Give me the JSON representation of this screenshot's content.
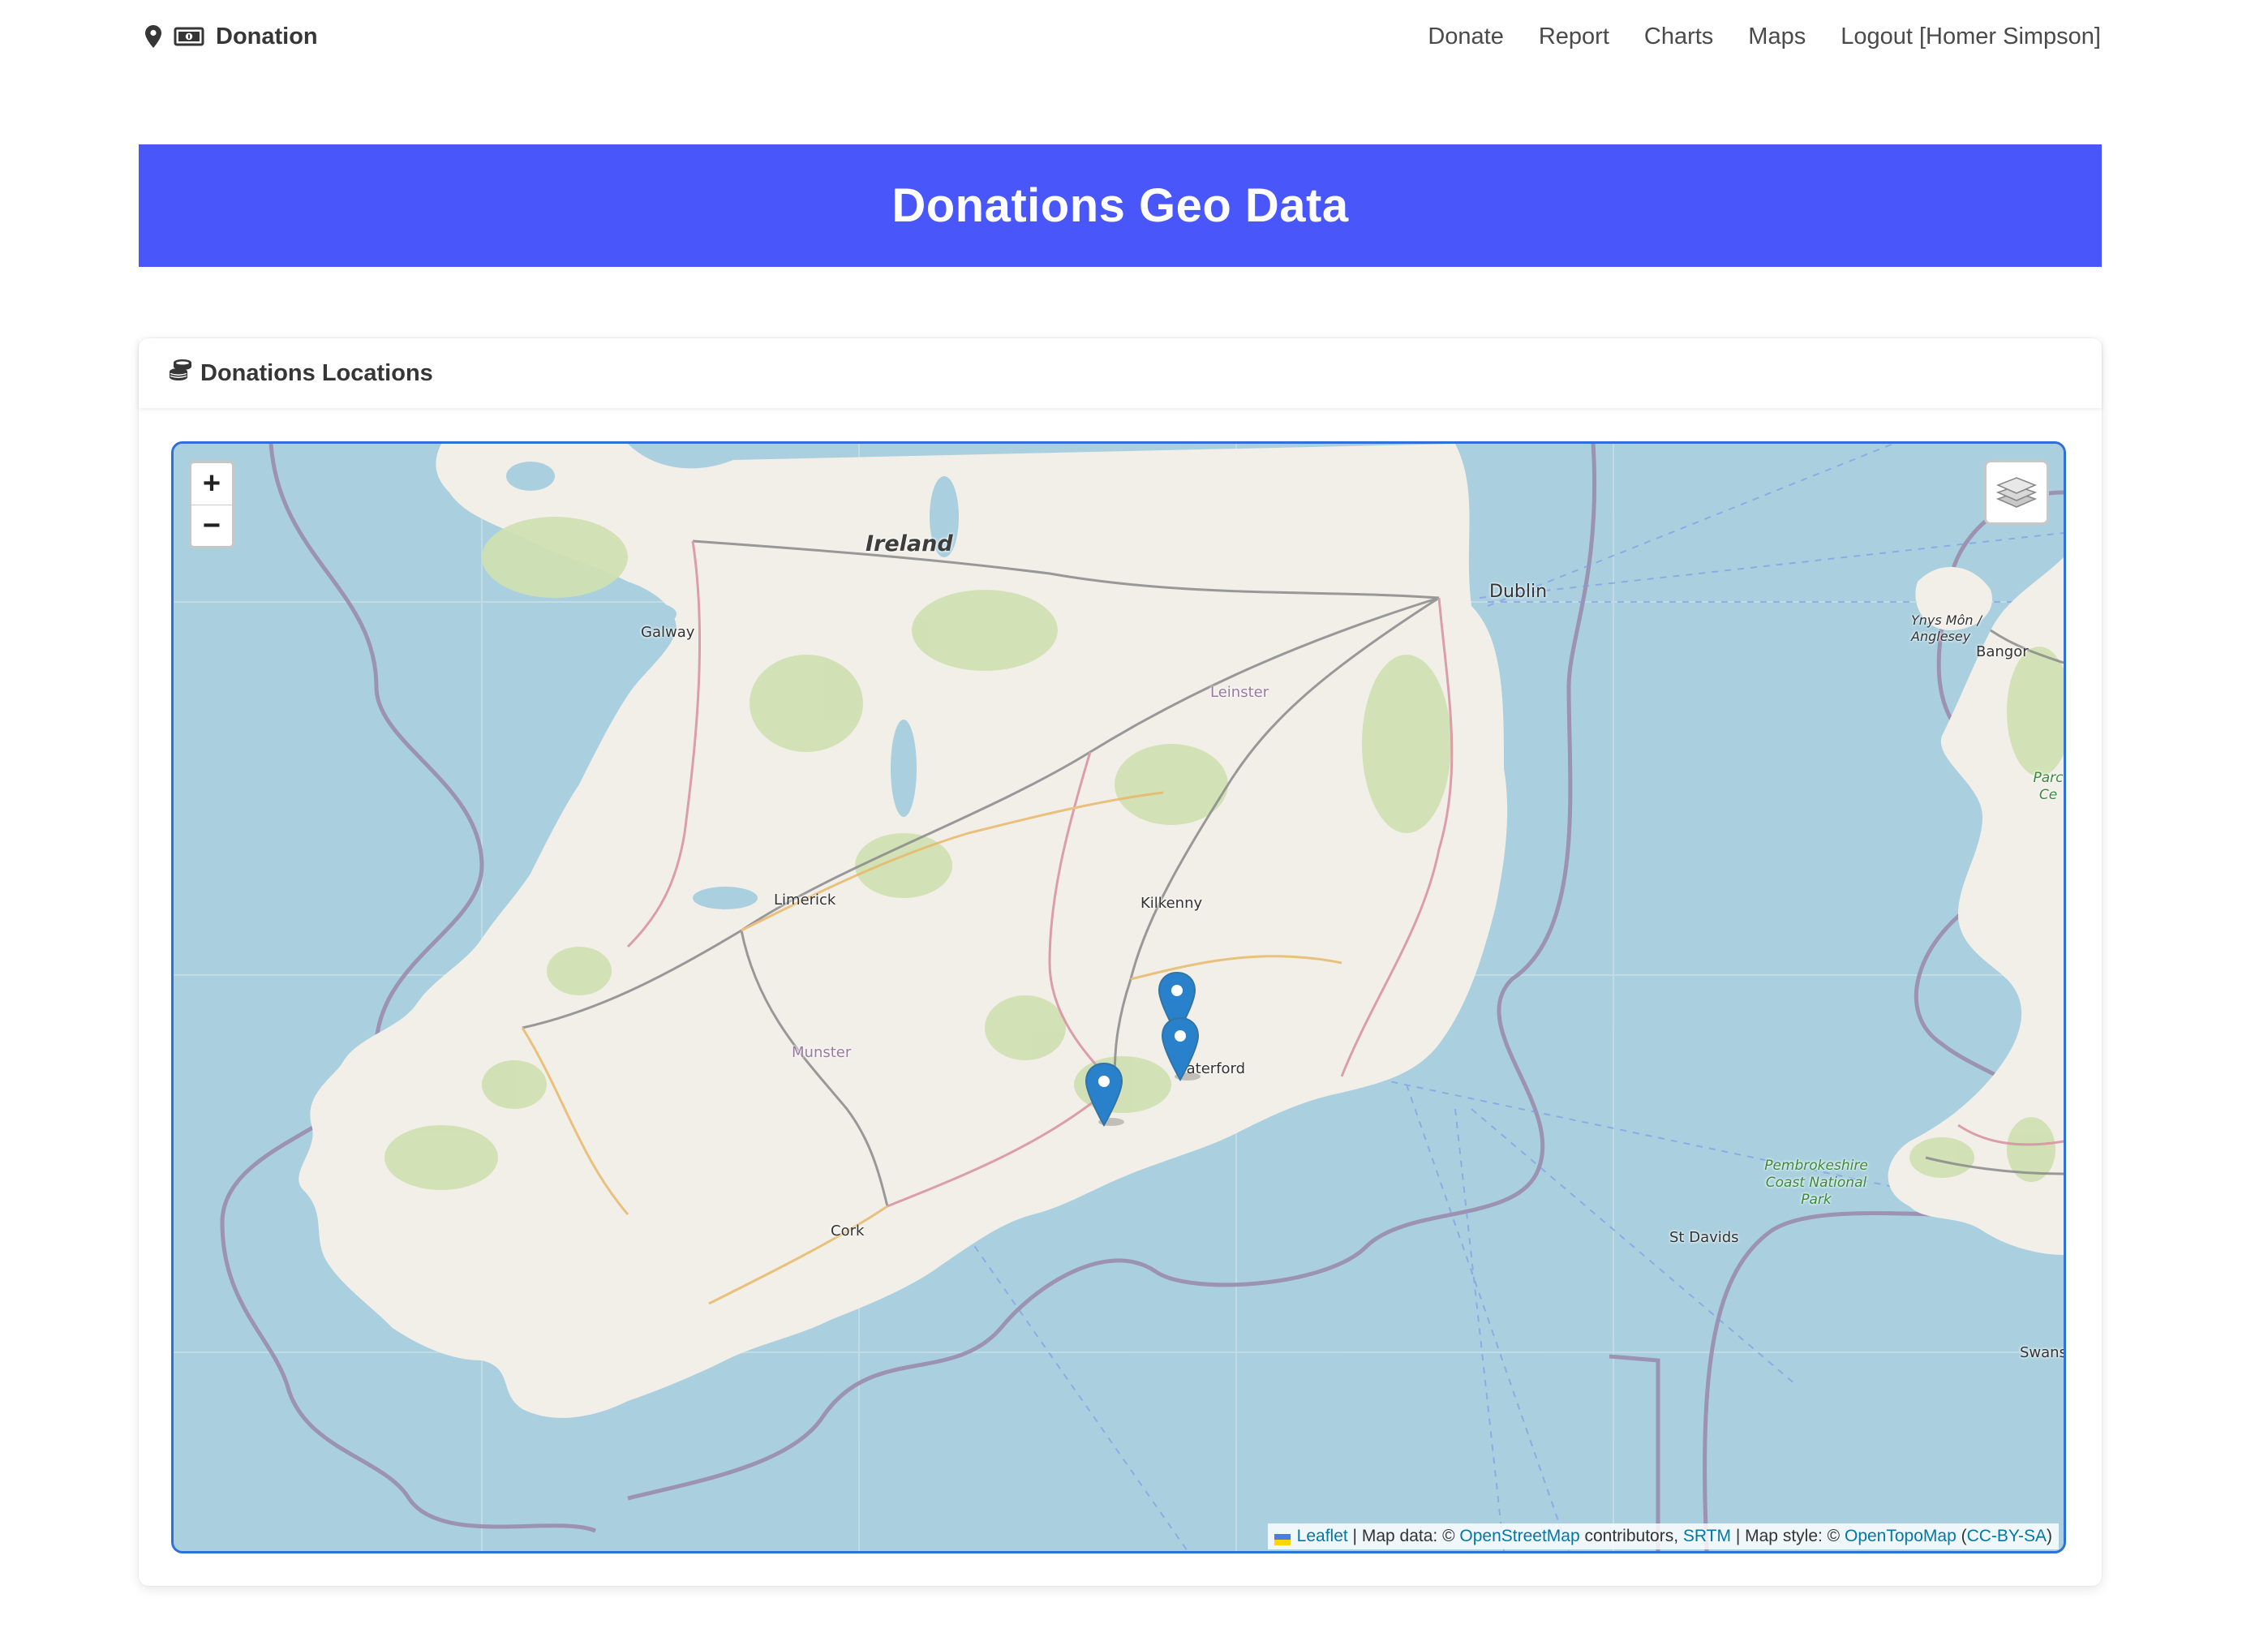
{
  "nav": {
    "brand": "Donation",
    "links": [
      "Donate",
      "Report",
      "Charts",
      "Maps",
      "Logout [Homer Simpson]"
    ]
  },
  "hero": {
    "title": "Donations Geo Data"
  },
  "card": {
    "title": "Donations Locations"
  },
  "map": {
    "zoom_in": "+",
    "zoom_out": "−",
    "labels": {
      "ireland": "Ireland",
      "dublin": "Dublin",
      "galway": "Galway",
      "limerick": "Limerick",
      "kilkenny": "Kilkenny",
      "waterford": "Waterford",
      "cork": "Cork",
      "munster": "Munster",
      "leinster": "Leinster",
      "anglesey": "Ynys Môn / Anglesey",
      "bangor": "Bangor",
      "parc": "Parc Ce",
      "pembrokeshire": "Pembrokeshire Coast National Park",
      "st_davids": "St Davids",
      "swansea": "Swans"
    },
    "markers": 3,
    "attribution": {
      "leaflet": "Leaflet",
      "map_data": " | Map data: © ",
      "osm": "OpenStreetMap",
      "contributors": " contributors, ",
      "srtm": "SRTM",
      "map_style": " | Map style: © ",
      "opentopomap": "OpenTopoMap",
      "open_paren": " (",
      "license": "CC-BY-SA",
      "close_paren": ")"
    }
  },
  "colors": {
    "hero": "#4856fa",
    "sea": "#aad0e0",
    "land": "#f2efe9",
    "marker": "#2a81cb",
    "map_border": "#2f6fd8"
  }
}
